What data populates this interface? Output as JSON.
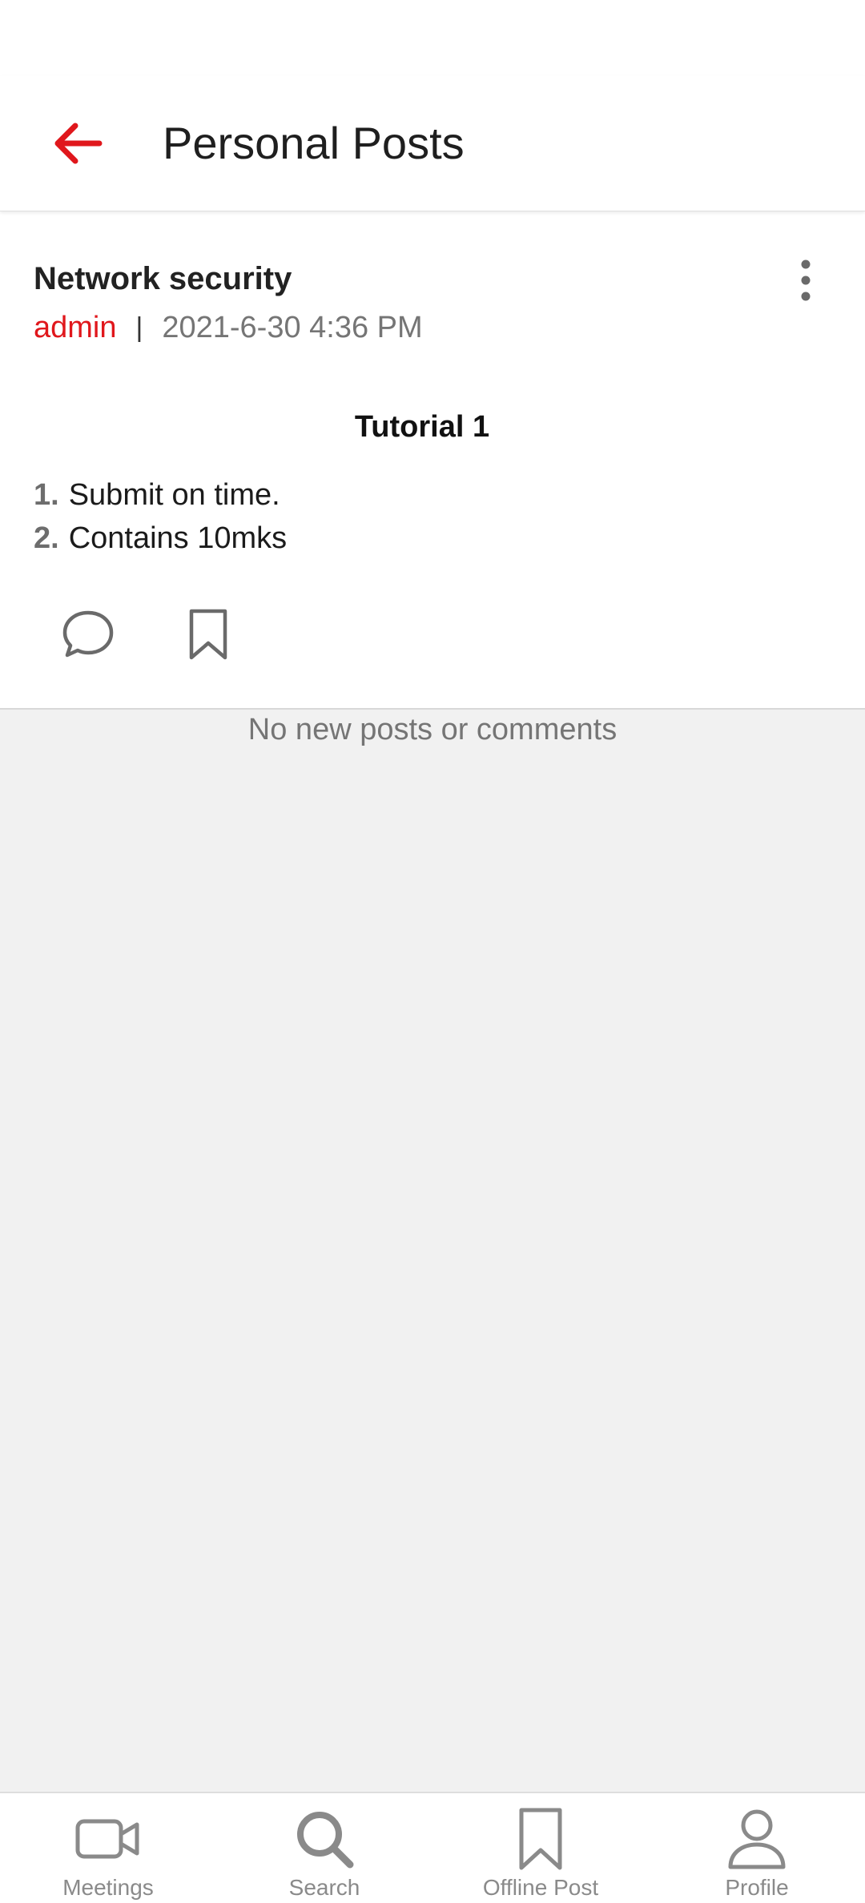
{
  "header": {
    "title": "Personal Posts",
    "back_icon": "arrow-left-icon",
    "accent_color": "#e0171c"
  },
  "post": {
    "title": "Network security",
    "author": "admin",
    "separator": "|",
    "timestamp": "2021-6-30 4:36 PM",
    "heading": "Tutorial 1",
    "items": [
      {
        "num": "1.",
        "text": "Submit on time."
      },
      {
        "num": "2.",
        "text": "Contains 10mks"
      }
    ],
    "more_icon": "more-vertical-icon",
    "comment_icon": "comment-bubble-icon",
    "bookmark_icon": "bookmark-icon"
  },
  "feed": {
    "empty_message": "No new posts or comments"
  },
  "bottom_nav": {
    "items": [
      {
        "label": "Meetings",
        "icon": "video-camera-icon"
      },
      {
        "label": "Search",
        "icon": "search-icon"
      },
      {
        "label": "Offline Post",
        "icon": "bookmark-icon"
      },
      {
        "label": "Profile",
        "icon": "person-icon"
      }
    ]
  }
}
